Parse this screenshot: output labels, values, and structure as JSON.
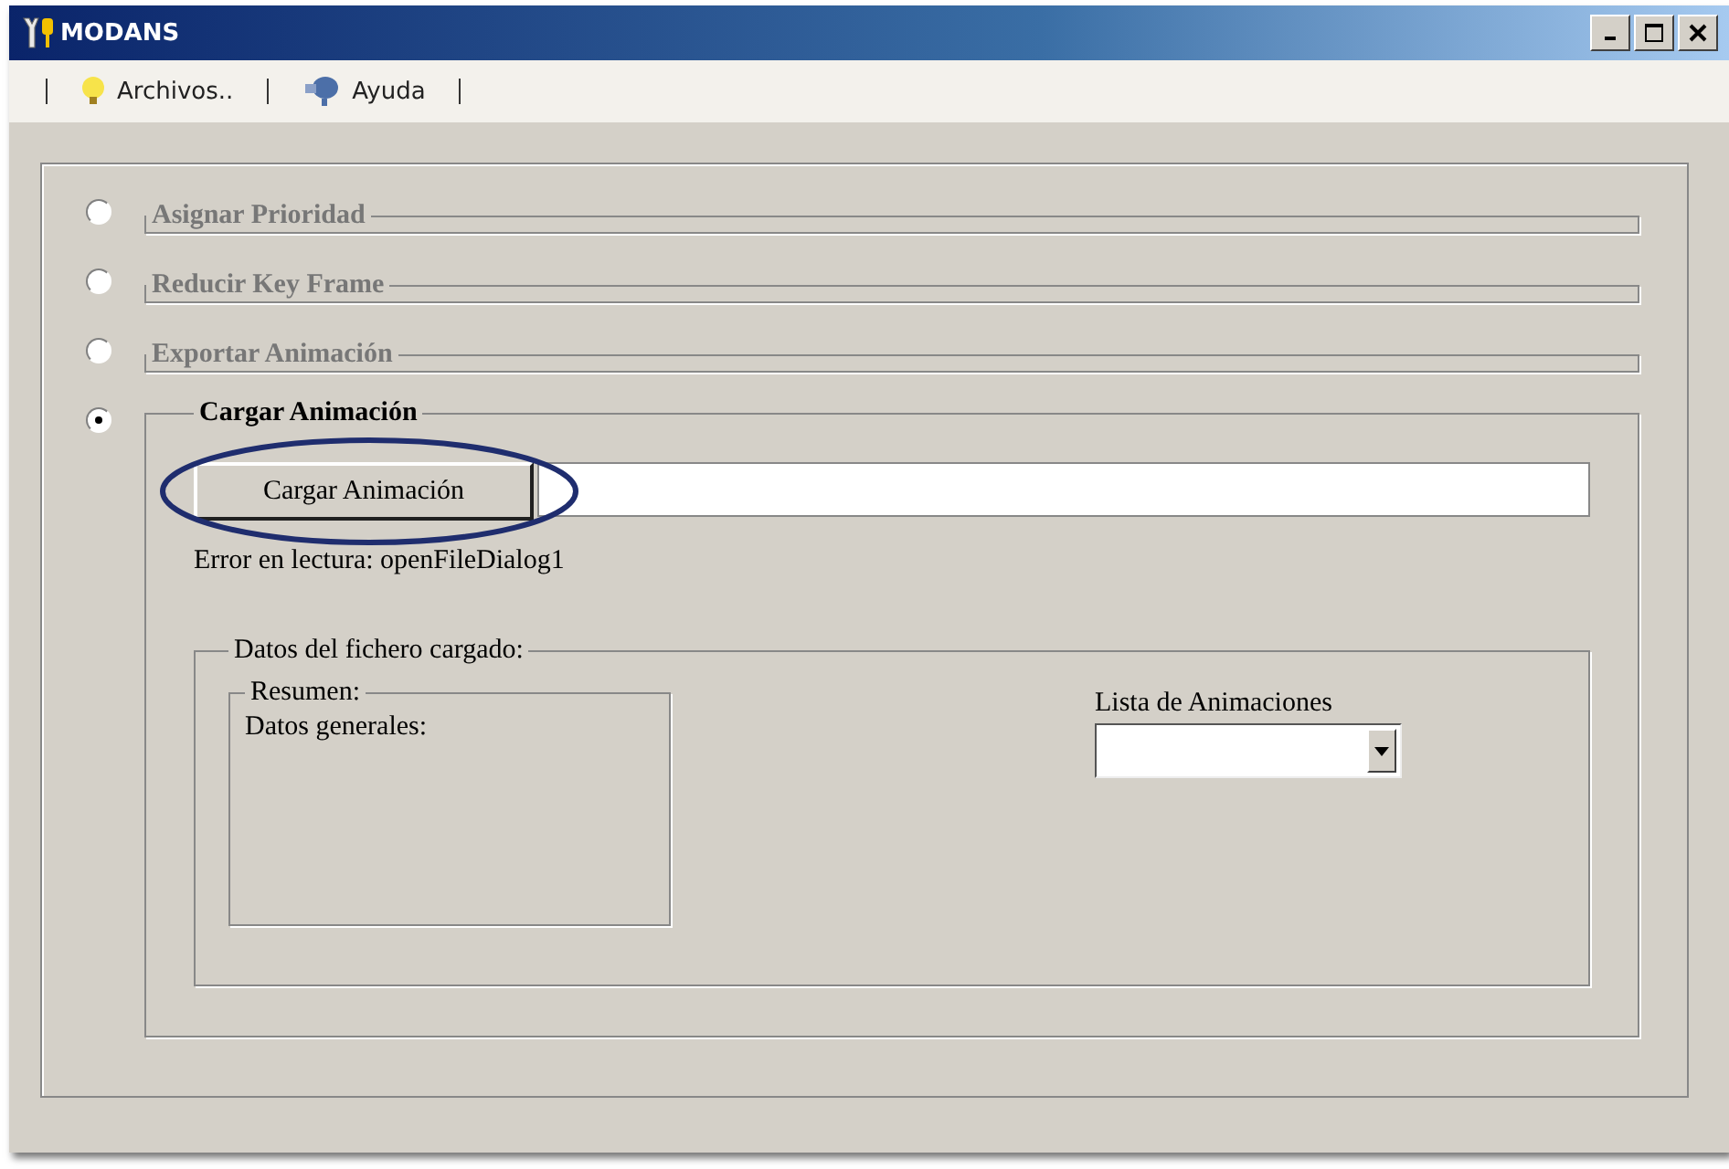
{
  "window": {
    "title": "MODANS"
  },
  "menu": [
    "Archivos..",
    "Ayuda"
  ],
  "options": [
    {
      "label": "Asignar Prioridad",
      "selected": false
    },
    {
      "label": "Reducir Key Frame",
      "selected": false
    },
    {
      "label": "Exportar Animación",
      "selected": false
    },
    {
      "label": "Cargar Animación",
      "selected": true
    }
  ],
  "load": {
    "button": "Cargar Animación",
    "highlighted": true,
    "error": "Error en lectura: openFileDialog1",
    "file_group": "Datos del fichero cargado:",
    "summary_group": "Resumen:",
    "summary_text": "Datos generales:",
    "list_label": "Lista de Animaciones"
  }
}
